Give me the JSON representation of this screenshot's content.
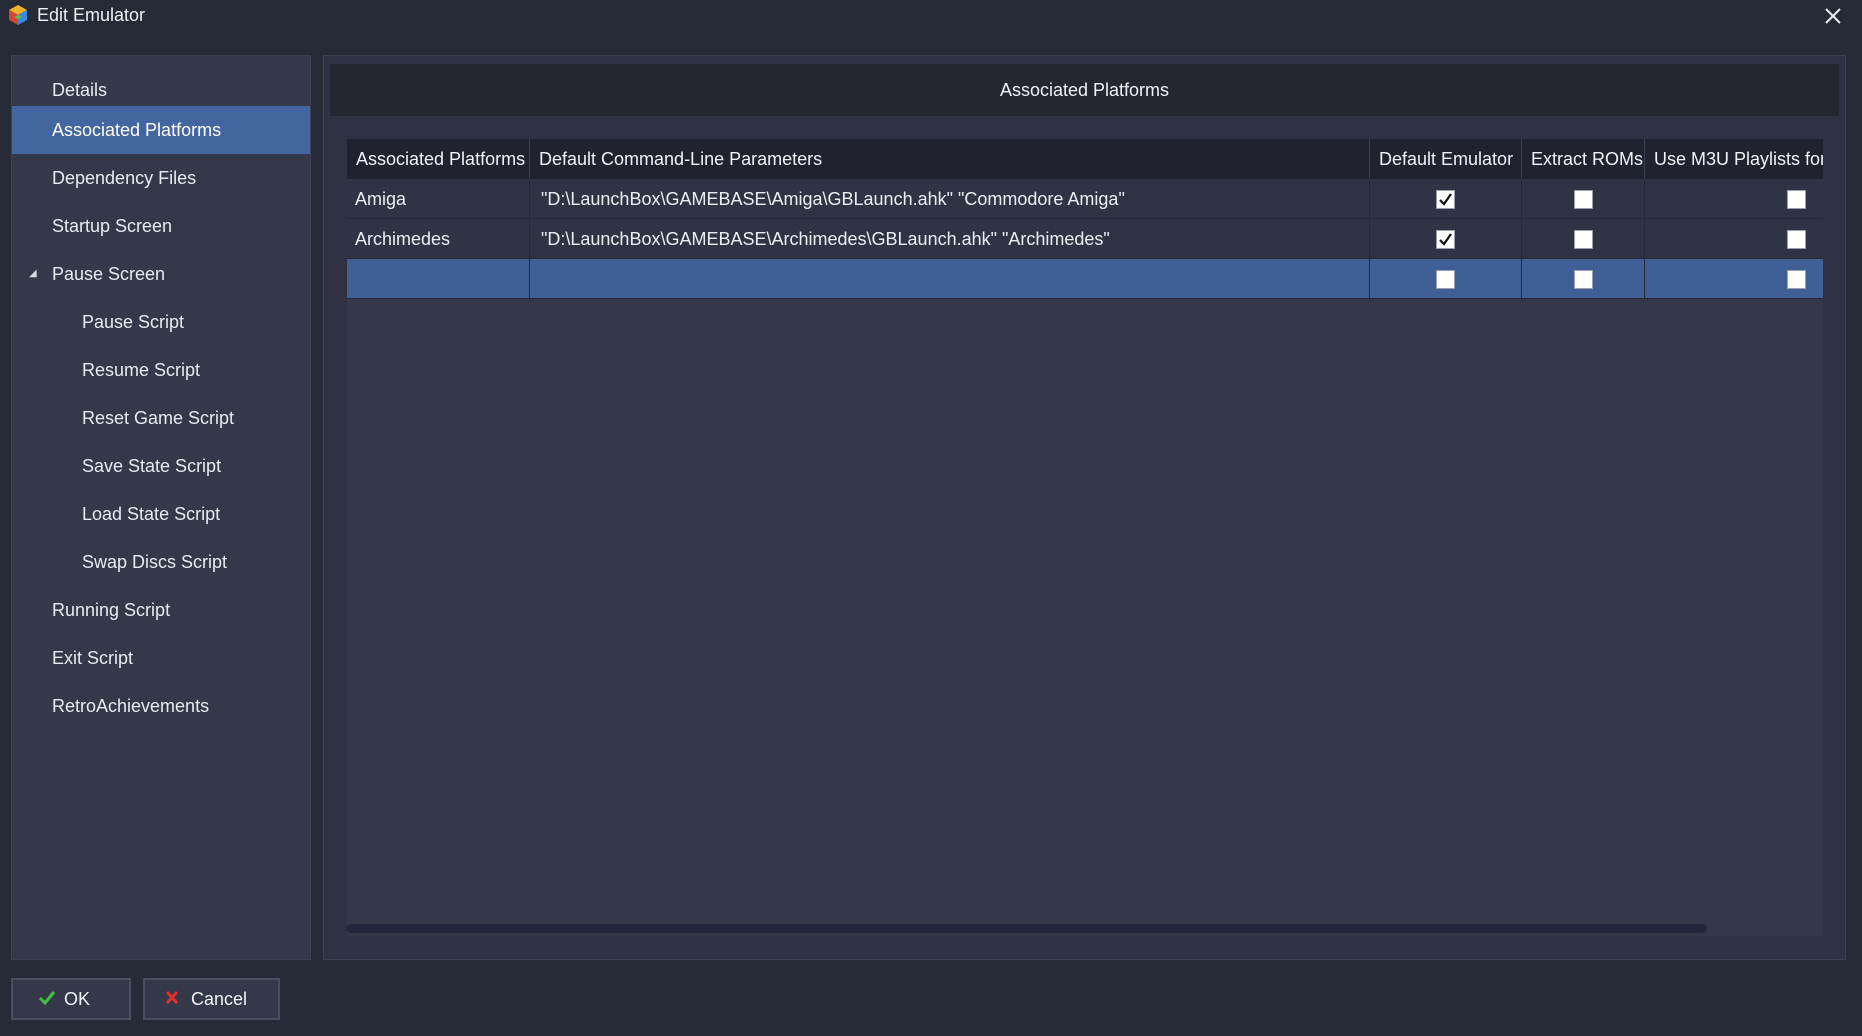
{
  "window": {
    "title": "Edit Emulator",
    "icon": "launchbox-app-icon",
    "close_icon": "close-icon"
  },
  "sidebar": {
    "items": [
      {
        "label": "Details",
        "level": 1,
        "selected": false
      },
      {
        "label": "Associated Platforms",
        "level": 1,
        "selected": true
      },
      {
        "label": "Dependency Files",
        "level": 1,
        "selected": false
      },
      {
        "label": "Startup Screen",
        "level": 1,
        "selected": false
      },
      {
        "label": "Pause Screen",
        "level": 1,
        "selected": false,
        "expanded": true
      },
      {
        "label": "Pause Script",
        "level": 2,
        "selected": false
      },
      {
        "label": "Resume Script",
        "level": 2,
        "selected": false
      },
      {
        "label": "Reset Game Script",
        "level": 2,
        "selected": false
      },
      {
        "label": "Save State Script",
        "level": 2,
        "selected": false
      },
      {
        "label": "Load State Script",
        "level": 2,
        "selected": false
      },
      {
        "label": "Swap Discs Script",
        "level": 2,
        "selected": false
      },
      {
        "label": "Running Script",
        "level": 1,
        "selected": false
      },
      {
        "label": "Exit Script",
        "level": 1,
        "selected": false
      },
      {
        "label": "RetroAchievements",
        "level": 1,
        "selected": false
      }
    ]
  },
  "main": {
    "header": "Associated Platforms",
    "grid": {
      "columns": [
        "Associated Platforms",
        "Default Command-Line Parameters",
        "Default Emulator",
        "Extract ROMs",
        "Use M3U Playlists for"
      ],
      "rows": [
        {
          "platform": "Amiga",
          "params": "\"D:\\LaunchBox\\GAMEBASE\\Amiga\\GBLaunch.ahk\" \"Commodore Amiga\"",
          "default_emulator": true,
          "extract_roms": false,
          "use_m3u": false,
          "selected": false
        },
        {
          "platform": "Archimedes",
          "params": "\"D:\\LaunchBox\\GAMEBASE\\Archimedes\\GBLaunch.ahk\" \"Archimedes\"",
          "default_emulator": true,
          "extract_roms": false,
          "use_m3u": false,
          "selected": false
        },
        {
          "platform": "",
          "params": "",
          "default_emulator": false,
          "extract_roms": false,
          "use_m3u": false,
          "selected": true
        }
      ]
    }
  },
  "buttons": {
    "ok_label": "OK",
    "ok_icon": "checkmark-icon",
    "cancel_label": "Cancel",
    "cancel_icon": "red-x-icon"
  },
  "colors": {
    "background": "#272a37",
    "selection": "#4466a0",
    "ok_check": "#3cc43c",
    "cancel_x": "#e03030"
  }
}
